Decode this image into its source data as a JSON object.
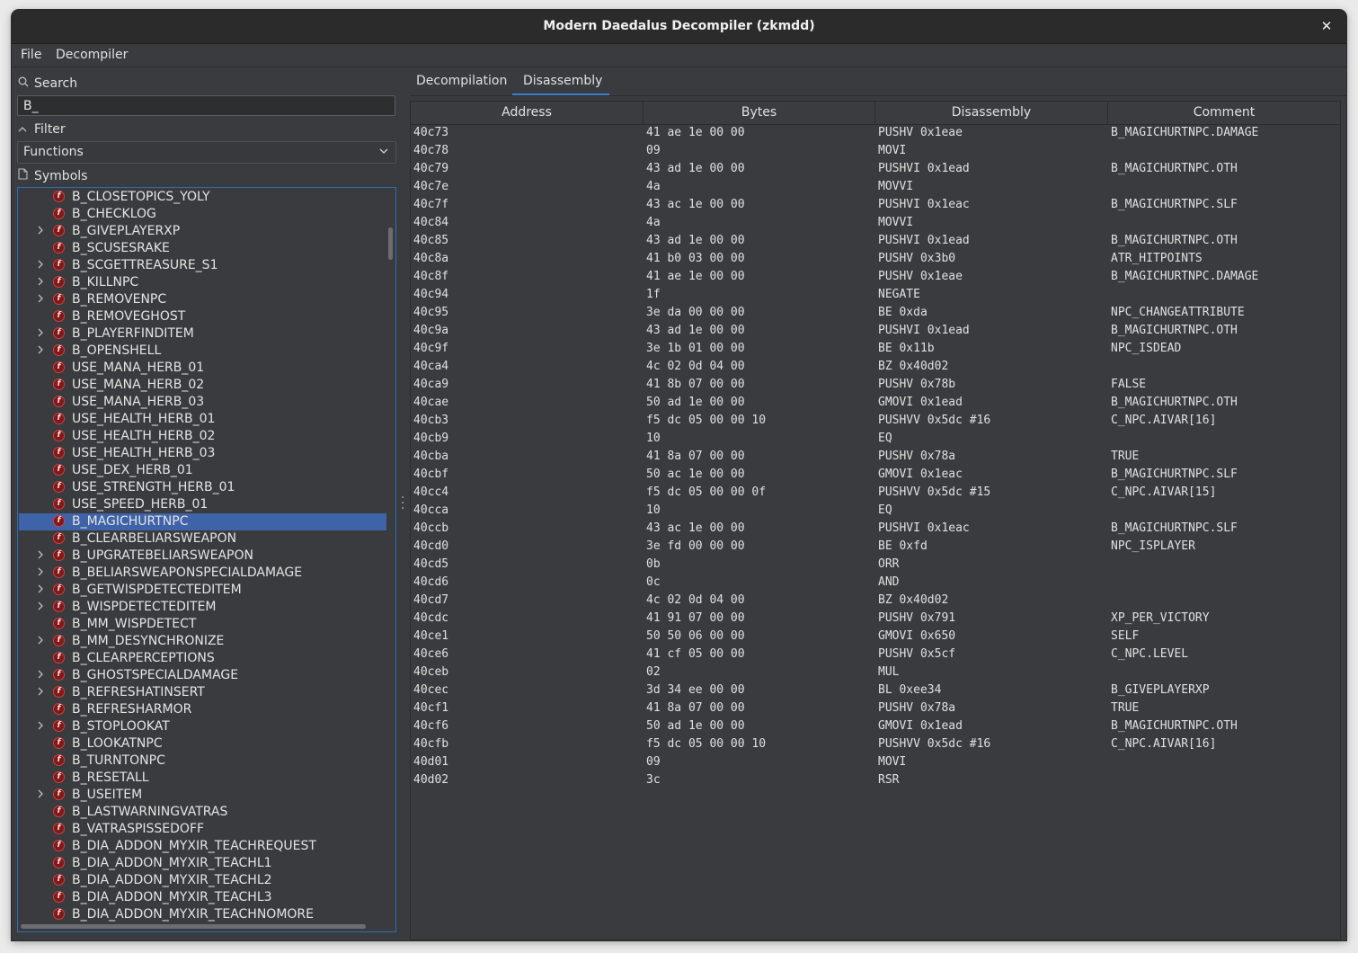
{
  "window": {
    "title": "Modern Daedalus Decompiler (zkmdd)",
    "close_glyph": "✕"
  },
  "menu": {
    "file": "File",
    "decompiler": "Decompiler"
  },
  "sidebar": {
    "search_label": "Search",
    "search_value": "B_",
    "filter_label": "Filter",
    "filter_selected": "Functions",
    "symbols_label": "Symbols",
    "items": [
      {
        "name": "B_CLOSETOPICS_YOLY",
        "expandable": false
      },
      {
        "name": "B_CHECKLOG",
        "expandable": false
      },
      {
        "name": "B_GIVEPLAYERXP",
        "expandable": true
      },
      {
        "name": "B_SCUSESRAKE",
        "expandable": false
      },
      {
        "name": "B_SCGETTREASURE_S1",
        "expandable": true
      },
      {
        "name": "B_KILLNPC",
        "expandable": true
      },
      {
        "name": "B_REMOVENPC",
        "expandable": true
      },
      {
        "name": "B_REMOVEGHOST",
        "expandable": false
      },
      {
        "name": "B_PLAYERFINDITEM",
        "expandable": true
      },
      {
        "name": "B_OPENSHELL",
        "expandable": true
      },
      {
        "name": "USE_MANA_HERB_01",
        "expandable": false
      },
      {
        "name": "USE_MANA_HERB_02",
        "expandable": false
      },
      {
        "name": "USE_MANA_HERB_03",
        "expandable": false
      },
      {
        "name": "USE_HEALTH_HERB_01",
        "expandable": false
      },
      {
        "name": "USE_HEALTH_HERB_02",
        "expandable": false
      },
      {
        "name": "USE_HEALTH_HERB_03",
        "expandable": false
      },
      {
        "name": "USE_DEX_HERB_01",
        "expandable": false
      },
      {
        "name": "USE_STRENGTH_HERB_01",
        "expandable": false
      },
      {
        "name": "USE_SPEED_HERB_01",
        "expandable": false
      },
      {
        "name": "B_MAGICHURTNPC",
        "expandable": false,
        "selected": true
      },
      {
        "name": "B_CLEARBELIARSWEAPON",
        "expandable": false
      },
      {
        "name": "B_UPGRATEBELIARSWEAPON",
        "expandable": true
      },
      {
        "name": "B_BELIARSWEAPONSPECIALDAMAGE",
        "expandable": true
      },
      {
        "name": "B_GETWISPDETECTEDITEM",
        "expandable": true
      },
      {
        "name": "B_WISPDETECTEDITEM",
        "expandable": true
      },
      {
        "name": "B_MM_WISPDETECT",
        "expandable": false
      },
      {
        "name": "B_MM_DESYNCHRONIZE",
        "expandable": true
      },
      {
        "name": "B_CLEARPERCEPTIONS",
        "expandable": false
      },
      {
        "name": "B_GHOSTSPECIALDAMAGE",
        "expandable": true
      },
      {
        "name": "B_REFRESHATINSERT",
        "expandable": true
      },
      {
        "name": "B_REFRESHARMOR",
        "expandable": false
      },
      {
        "name": "B_STOPLOOKAT",
        "expandable": true
      },
      {
        "name": "B_LOOKATNPC",
        "expandable": false
      },
      {
        "name": "B_TURNTONPC",
        "expandable": false
      },
      {
        "name": "B_RESETALL",
        "expandable": false
      },
      {
        "name": "B_USEITEM",
        "expandable": true
      },
      {
        "name": "B_LASTWARNINGVATRAS",
        "expandable": false
      },
      {
        "name": "B_VATRASPISSEDOFF",
        "expandable": false
      },
      {
        "name": "B_DIA_ADDON_MYXIR_TEACHREQUEST",
        "expandable": false
      },
      {
        "name": "B_DIA_ADDON_MYXIR_TEACHL1",
        "expandable": false
      },
      {
        "name": "B_DIA_ADDON_MYXIR_TEACHL2",
        "expandable": false
      },
      {
        "name": "B_DIA_ADDON_MYXIR_TEACHL3",
        "expandable": false
      },
      {
        "name": "B_DIA_ADDON_MYXIR_TEACHNOMORE",
        "expandable": false
      }
    ]
  },
  "tabs": [
    {
      "label": "Decompilation",
      "active": false
    },
    {
      "label": "Disassembly",
      "active": true
    }
  ],
  "table": {
    "columns": [
      "Address",
      "Bytes",
      "Disassembly",
      "Comment"
    ],
    "rows": [
      [
        "40c73",
        "41 ae 1e 00 00",
        "PUSHV 0x1eae",
        "B_MAGICHURTNPC.DAMAGE"
      ],
      [
        "40c78",
        "09",
        "MOVI",
        ""
      ],
      [
        "40c79",
        "43 ad 1e 00 00",
        "PUSHVI 0x1ead",
        "B_MAGICHURTNPC.OTH"
      ],
      [
        "40c7e",
        "4a",
        "MOVVI",
        ""
      ],
      [
        "40c7f",
        "43 ac 1e 00 00",
        "PUSHVI 0x1eac",
        "B_MAGICHURTNPC.SLF"
      ],
      [
        "40c84",
        "4a",
        "MOVVI",
        ""
      ],
      [
        "40c85",
        "43 ad 1e 00 00",
        "PUSHVI 0x1ead",
        "B_MAGICHURTNPC.OTH"
      ],
      [
        "40c8a",
        "41 b0 03 00 00",
        "PUSHV 0x3b0",
        "ATR_HITPOINTS"
      ],
      [
        "40c8f",
        "41 ae 1e 00 00",
        "PUSHV 0x1eae",
        "B_MAGICHURTNPC.DAMAGE"
      ],
      [
        "40c94",
        "1f",
        "NEGATE",
        ""
      ],
      [
        "40c95",
        "3e da 00 00 00",
        "BE 0xda",
        "NPC_CHANGEATTRIBUTE"
      ],
      [
        "40c9a",
        "43 ad 1e 00 00",
        "PUSHVI 0x1ead",
        "B_MAGICHURTNPC.OTH"
      ],
      [
        "40c9f",
        "3e 1b 01 00 00",
        "BE 0x11b",
        "NPC_ISDEAD"
      ],
      [
        "40ca4",
        "4c 02 0d 04 00",
        "BZ 0x40d02",
        ""
      ],
      [
        "40ca9",
        "41 8b 07 00 00",
        "PUSHV 0x78b",
        "FALSE"
      ],
      [
        "40cae",
        "50 ad 1e 00 00",
        "GMOVI 0x1ead",
        "B_MAGICHURTNPC.OTH"
      ],
      [
        "40cb3",
        "f5 dc 05 00 00 10",
        "PUSHVV 0x5dc #16",
        "C_NPC.AIVAR[16]"
      ],
      [
        "40cb9",
        "10",
        "EQ",
        ""
      ],
      [
        "40cba",
        "41 8a 07 00 00",
        "PUSHV 0x78a",
        "TRUE"
      ],
      [
        "40cbf",
        "50 ac 1e 00 00",
        "GMOVI 0x1eac",
        "B_MAGICHURTNPC.SLF"
      ],
      [
        "40cc4",
        "f5 dc 05 00 00 0f",
        "PUSHVV 0x5dc #15",
        "C_NPC.AIVAR[15]"
      ],
      [
        "40cca",
        "10",
        "EQ",
        ""
      ],
      [
        "40ccb",
        "43 ac 1e 00 00",
        "PUSHVI 0x1eac",
        "B_MAGICHURTNPC.SLF"
      ],
      [
        "40cd0",
        "3e fd 00 00 00",
        "BE 0xfd",
        "NPC_ISPLAYER"
      ],
      [
        "40cd5",
        "0b",
        "ORR",
        ""
      ],
      [
        "40cd6",
        "0c",
        "AND",
        ""
      ],
      [
        "40cd7",
        "4c 02 0d 04 00",
        "BZ 0x40d02",
        ""
      ],
      [
        "40cdc",
        "41 91 07 00 00",
        "PUSHV 0x791",
        "XP_PER_VICTORY"
      ],
      [
        "40ce1",
        "50 50 06 00 00",
        "GMOVI 0x650",
        "SELF"
      ],
      [
        "40ce6",
        "41 cf 05 00 00",
        "PUSHV 0x5cf",
        "C_NPC.LEVEL"
      ],
      [
        "40ceb",
        "02",
        "MUL",
        ""
      ],
      [
        "40cec",
        "3d 34 ee 00 00",
        "BL 0xee34",
        "B_GIVEPLAYERXP"
      ],
      [
        "40cf1",
        "41 8a 07 00 00",
        "PUSHV 0x78a",
        "TRUE"
      ],
      [
        "40cf6",
        "50 ad 1e 00 00",
        "GMOVI 0x1ead",
        "B_MAGICHURTNPC.OTH"
      ],
      [
        "40cfb",
        "f5 dc 05 00 00 10",
        "PUSHVV 0x5dc #16",
        "C_NPC.AIVAR[16]"
      ],
      [
        "40d01",
        "09",
        "MOVI",
        ""
      ],
      [
        "40d02",
        "3c",
        "RSR",
        ""
      ]
    ]
  },
  "colors": {
    "accent": "#3d7fd0",
    "selection": "#3f63a8",
    "function_icon": "#d04040"
  }
}
